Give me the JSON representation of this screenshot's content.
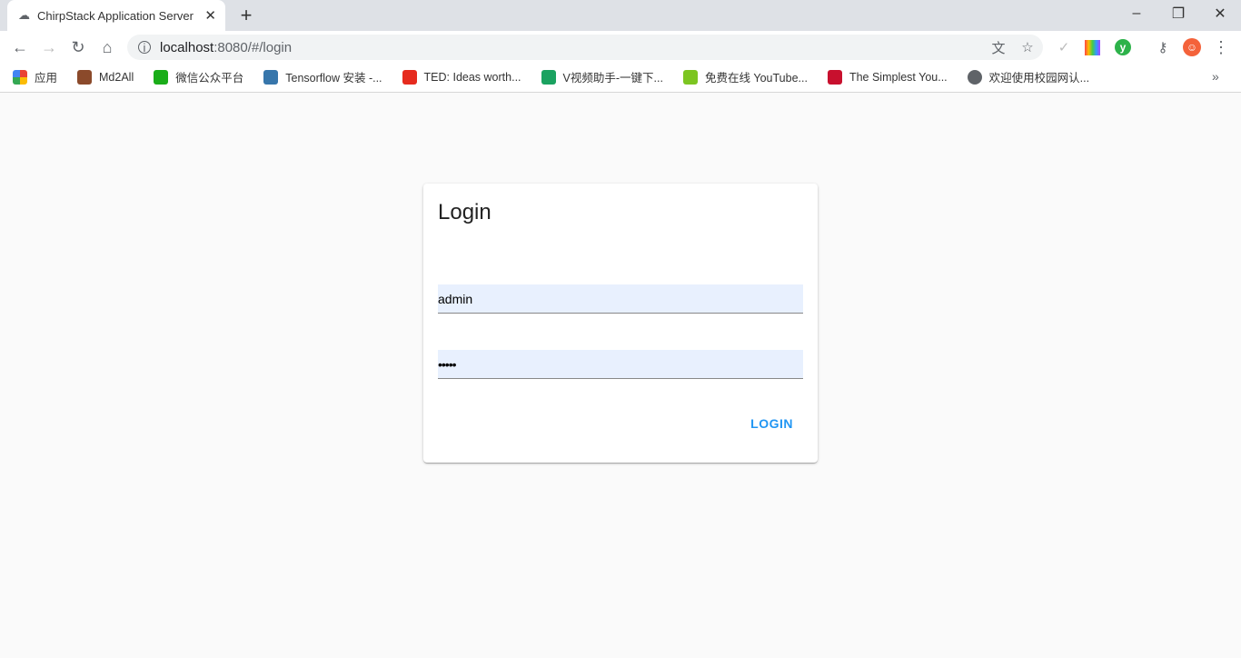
{
  "browser": {
    "tab_title": "ChirpStack Application Server",
    "url_host": "localhost",
    "url_path": ":8080/#/login",
    "bookmarks": [
      {
        "label": "应用",
        "icon": "apps-grid-icon",
        "color": "#4285f4"
      },
      {
        "label": "Md2All",
        "icon": "md2all-icon",
        "color": "#8b4a2b"
      },
      {
        "label": "微信公众平台",
        "icon": "wechat-icon",
        "color": "#1aad19"
      },
      {
        "label": "Tensorflow 安装 -...",
        "icon": "python-icon",
        "color": "#3776ab"
      },
      {
        "label": "TED: Ideas worth...",
        "icon": "ted-icon",
        "color": "#e62b1e"
      },
      {
        "label": "V视频助手-一键下...",
        "icon": "video-icon",
        "color": "#1aa260"
      },
      {
        "label": "免费在线 YouTube...",
        "icon": "download-arrow-icon",
        "color": "#7cc521"
      },
      {
        "label": "The Simplest You...",
        "icon": "download-red-icon",
        "color": "#c8102e"
      },
      {
        "label": "欢迎使用校园网认...",
        "icon": "globe-icon",
        "color": "#5f6368"
      }
    ]
  },
  "login": {
    "title": "Login",
    "username_value": "admin",
    "password_value": "•••••",
    "submit_label": "LOGIN",
    "accent_color": "#2196f3"
  }
}
